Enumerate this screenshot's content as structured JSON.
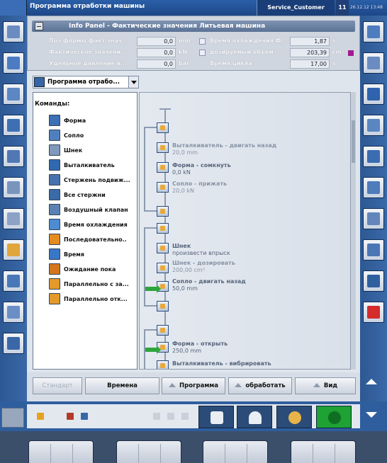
{
  "title_bar": {
    "title": "Программа отработки машины",
    "user": "Service_Customer",
    "number": "11",
    "datetime": "26.12.12 13:48"
  },
  "info_panel": {
    "title": "Info Panel - Фактические значения Литьевая машина",
    "rows": [
      {
        "label": "Поз.формы факт.знач",
        "value": "0,0",
        "unit": "mm"
      },
      {
        "label": "Фактическое значени...",
        "value": "0,0",
        "unit": "kN"
      },
      {
        "label": "Удельное давление в...",
        "value": "0,0",
        "unit": "bar"
      }
    ],
    "right_rows": [
      {
        "label": "Время охлаждения Ф...",
        "value": "1,87",
        "unit": "s"
      },
      {
        "label": "дозируемый объём ...",
        "value": "203,39",
        "unit": "cm³"
      },
      {
        "label": "Время цикла",
        "value": "17,00",
        "unit": "s"
      }
    ]
  },
  "program_select": {
    "value": "Программа отрабо..."
  },
  "commands": {
    "title": "Команды:",
    "items": [
      {
        "label": "Форма",
        "icon": "mold-icon",
        "color": "#3b6fb6"
      },
      {
        "label": "Сопло",
        "icon": "nozzle-icon",
        "color": "#4f7fbf"
      },
      {
        "label": "Шнек",
        "icon": "screw-icon",
        "color": "#7f98bd"
      },
      {
        "label": "Выталкиватель",
        "icon": "ejector-icon",
        "color": "#2f6ab0"
      },
      {
        "label": "Стержень подвиж...",
        "icon": "core-icon",
        "color": "#4872ad"
      },
      {
        "label": "Все стержни",
        "icon": "all-cores-icon",
        "color": "#3a6aaa"
      },
      {
        "label": "Воздушный клапан",
        "icon": "air-valve-icon",
        "color": "#5b80b6"
      },
      {
        "label": "Время охлаждения",
        "icon": "cooling-icon",
        "color": "#4d8bd3"
      },
      {
        "label": "Последовательно..",
        "icon": "sequence-icon",
        "color": "#e48c1e"
      },
      {
        "label": "Время",
        "icon": "clock-icon",
        "color": "#3877c6"
      },
      {
        "label": "Ожидание пока",
        "icon": "wait-icon",
        "color": "#d4761c"
      },
      {
        "label": "Параллельно с за...",
        "icon": "parallel-start-icon",
        "color": "#e39a2a"
      },
      {
        "label": "Параллельно отк...",
        "icon": "parallel-open-icon",
        "color": "#e39a2a"
      }
    ]
  },
  "sequence": {
    "steps": [
      {
        "title": "Выталкиватель - двигать назад",
        "value": "20,0 mm"
      },
      {
        "title": "Форма - сомкнуть",
        "value": "0,0 kN"
      },
      {
        "title": "Сопло - прижать",
        "value": "20,0 kN"
      },
      {
        "title": "Шнек",
        "value": "произвести впрыск"
      },
      {
        "title": "Шнек - дозировать",
        "value": "200,00 cm³"
      },
      {
        "title": "Сопло - двигать назад",
        "value": "50,0 mm"
      },
      {
        "title": "Форма - открыть",
        "value": "250,0 mm"
      },
      {
        "title": "Выталкиватель - вибрировать",
        "value": ""
      }
    ]
  },
  "tabs": {
    "standard": "Стандарт",
    "times": "Времена",
    "program": "Программа",
    "process": "обработать",
    "view": "Вид"
  },
  "colors": {
    "titlebar": "#1d4788",
    "sidebar": "#2d5893",
    "accent_green": "#1da233",
    "marker_purple": "#a01b8f"
  }
}
